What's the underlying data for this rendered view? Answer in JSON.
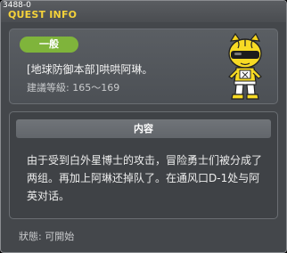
{
  "window": {
    "quest_id": "3488-0",
    "title": "QUEST INFO"
  },
  "header": {
    "category": "一般",
    "quest_name": "[地球防御本部]哄哄阿琳。",
    "level": "建議等級: 165～169"
  },
  "content": {
    "section_title": "内容",
    "description": "由于受到白外星博士的攻击，冒险勇士们被分成了两组。再加上阿琳还掉队了。在通风口D-1处与阿英对话。"
  },
  "footer": {
    "status": "狀態:  可開始"
  },
  "colors": {
    "title": "#f4d23a",
    "category_pill": "#7fb43b",
    "window_bg": "#44474b"
  },
  "icons": {
    "npc": "yellow-masked-npc-icon"
  }
}
